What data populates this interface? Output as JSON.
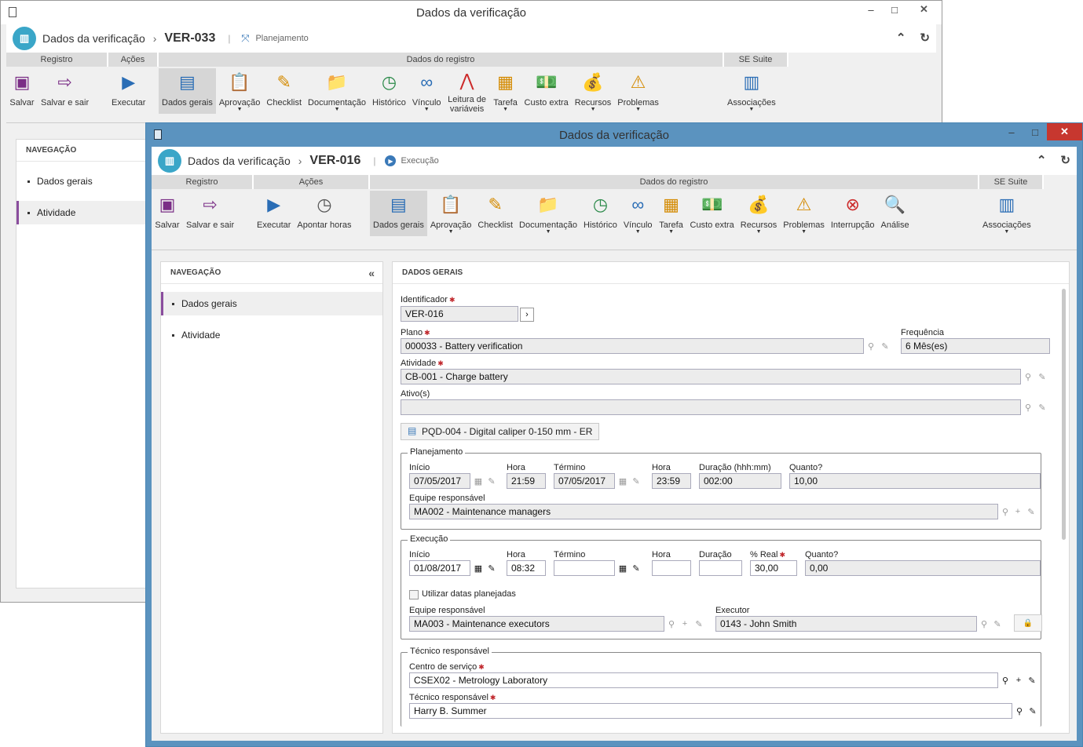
{
  "back": {
    "window_title": "Dados da verificação",
    "hdr_title": "Dados da verificação",
    "record_id": "VER-033",
    "status": "Planejamento",
    "groups": {
      "registro": "Registro",
      "acoes": "Ações",
      "dados": "Dados do registro",
      "suite": "SE Suite"
    },
    "buttons": [
      "Salvar",
      "Salvar e sair",
      "Executar",
      "Dados gerais",
      "Aprovação",
      "Checklist",
      "Documentação",
      "Histórico",
      "Vínculo",
      "Leitura de variáveis",
      "Tarefa",
      "Custo extra",
      "Recursos",
      "Problemas",
      "Associações"
    ],
    "nav": {
      "title": "NAVEGAÇÃO",
      "items": [
        "Dados gerais",
        "Atividade"
      ]
    }
  },
  "front": {
    "window_title": "Dados da verificação",
    "hdr_title": "Dados da verificação",
    "record_id": "VER-016",
    "status": "Execução",
    "groups": {
      "registro": "Registro",
      "acoes": "Ações",
      "dados": "Dados do registro",
      "suite": "SE Suite"
    },
    "buttons": [
      "Salvar",
      "Salvar e sair",
      "Executar",
      "Apontar horas",
      "Dados gerais",
      "Aprovação",
      "Checklist",
      "Documentação",
      "Histórico",
      "Vínculo",
      "Tarefa",
      "Custo extra",
      "Recursos",
      "Problemas",
      "Interrupção",
      "Análise",
      "Associações"
    ],
    "nav": {
      "title": "NAVEGAÇÃO",
      "items": [
        "Dados gerais",
        "Atividade"
      ]
    },
    "pane_title": "DADOS GERAIS",
    "form": {
      "identificador_label": "Identificador",
      "identificador": "VER-016",
      "plano_label": "Plano",
      "plano": "000033 - Battery verification",
      "frequencia_label": "Frequência",
      "frequencia": "6 Mês(es)",
      "atividade_label": "Atividade",
      "atividade": "CB-001 - Charge battery",
      "ativos_label": "Ativo(s)",
      "ativos": "",
      "chip": "PQD-004 - Digital caliper 0-150 mm - ER",
      "planejamento": {
        "legend": "Planejamento",
        "inicio_label": "Início",
        "inicio": "07/05/2017",
        "hora_label": "Hora",
        "hora": "21:59",
        "termino_label": "Término",
        "termino": "07/05/2017",
        "hora2_label": "Hora",
        "hora2": "23:59",
        "duracao_label": "Duração (hhh:mm)",
        "duracao": "002:00",
        "quanto_label": "Quanto?",
        "quanto": "10,00",
        "equipe_label": "Equipe responsável",
        "equipe": "MA002 - Maintenance managers"
      },
      "execucao": {
        "legend": "Execução",
        "inicio_label": "Início",
        "inicio": "01/08/2017",
        "hora_label": "Hora",
        "hora": "08:32",
        "termino_label": "Término",
        "termino": "",
        "hora2_label": "Hora",
        "hora2": "",
        "duracao_label": "Duração",
        "duracao": "",
        "real_label": "% Real",
        "real": "30,00",
        "quanto_label": "Quanto?",
        "quanto": "0,00",
        "usar_datas": "Utilizar datas planejadas",
        "equipe_label": "Equipe responsável",
        "equipe": "MA003 - Maintenance executors",
        "executor_label": "Executor",
        "executor": "0143 - John Smith"
      },
      "tecnico": {
        "legend": "Técnico responsável",
        "centro_label": "Centro de serviço",
        "centro": "CSEX02 - Metrology Laboratory",
        "tecnico_label": "Técnico responsável",
        "tecnico": "Harry B. Summer"
      }
    }
  },
  "colors": {
    "accent": "#5b93bf",
    "nav_selected": "#8a4d9e",
    "required": "#c0262b"
  }
}
